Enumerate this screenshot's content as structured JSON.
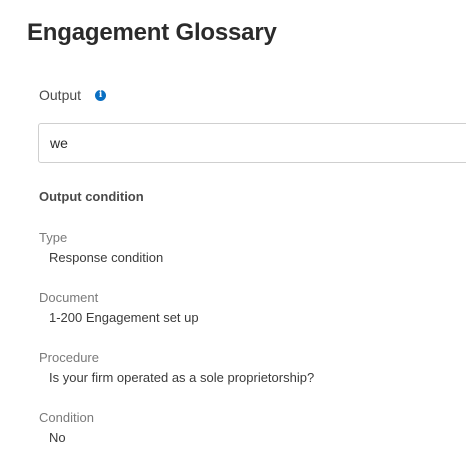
{
  "page": {
    "title": "Engagement Glossary"
  },
  "output": {
    "label": "Output",
    "info_icon": "info-icon",
    "value": "we"
  },
  "output_condition": {
    "heading": "Output condition",
    "fields": {
      "type": {
        "label": "Type",
        "value": "Response condition"
      },
      "document": {
        "label": "Document",
        "value": "1-200 Engagement set up"
      },
      "procedure": {
        "label": "Procedure",
        "value": "Is your firm operated as a sole proprietorship?"
      },
      "condition": {
        "label": "Condition",
        "value": "No"
      }
    }
  },
  "colors": {
    "info_icon": "#0a6fc2",
    "border": "#cfcfcf"
  }
}
